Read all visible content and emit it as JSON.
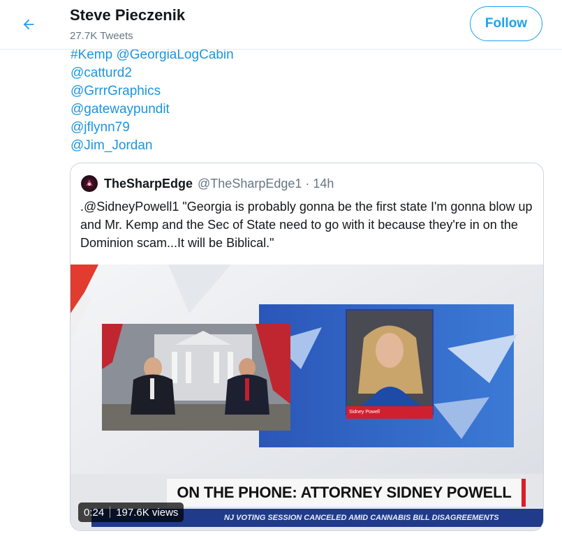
{
  "header": {
    "title": "Steve Pieczenik",
    "subtitle": "27.7K Tweets",
    "follow_label": "Follow"
  },
  "tweet": {
    "lines": [
      "#Kemp @GeorgiaLogCabin",
      "@catturd2",
      "@GrrrGraphics",
      "@gatewaypundit",
      "@jflynn79",
      "@Jim_Jordan"
    ]
  },
  "quote": {
    "name": "TheSharpEdge",
    "handle": "@TheSharpEdge1",
    "separator": "·",
    "time": "14h",
    "text": ".@SidneyPowell1 \"Georgia is probably gonna be the first state I'm gonna blow up and Mr. Kemp and the Sec of State need to go with it because they're in on the Dominion scam...It will be Biblical.\""
  },
  "video": {
    "lower_third": "ON THE PHONE: ATTORNEY SIDNEY POWELL",
    "ticker": "NJ VOTING SESSION CANCELED AMID CANNABIS BILL DISAGREEMENTS",
    "nametag": "Sidney Powell",
    "duration": "0:24",
    "views": "197.6K views"
  },
  "colors": {
    "accent": "#1da1f2",
    "link": "#1b95e0",
    "muted": "#657786",
    "text": "#14171a",
    "border": "#ccd6dd"
  },
  "icons": {
    "back": "arrow-left-icon"
  }
}
